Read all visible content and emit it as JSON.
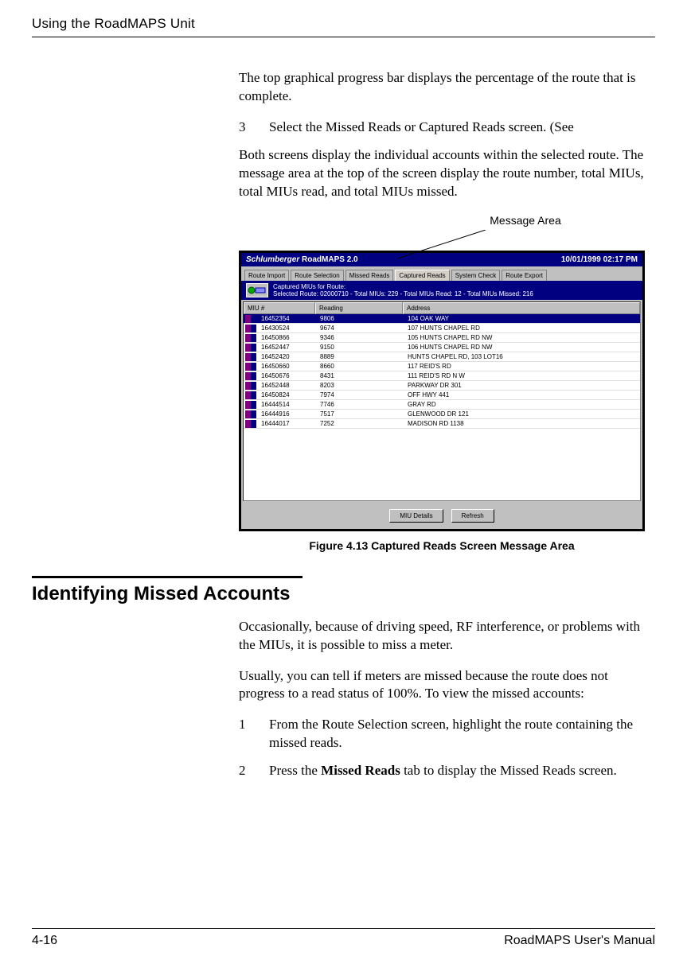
{
  "header": {
    "title": "Using the RoadMAPS Unit"
  },
  "intro": {
    "p1": "The top graphical progress bar displays the percentage of the route that is complete.",
    "step3_num": "3",
    "step3_text": "Select the Missed Reads or Captured Reads screen. (See",
    "step3_body": "Both screens display the individual accounts within the selected route. The message area at the top of the screen display the route number, total MIUs, total MIUs read, and total MIUs missed."
  },
  "callout": {
    "label": "Message Area"
  },
  "app": {
    "brand": "Schlumberger",
    "product": "RoadMAPS 2.0",
    "datetime": "10/01/1999 02:17 PM",
    "tabs": [
      "Route Import",
      "Route Selection",
      "Missed Reads",
      "Captured Reads",
      "System Check",
      "Route Export"
    ],
    "active_tab_index": 3,
    "msg_line1": "Captured MIUs for Route:",
    "msg_line2": "Selected Route: 02000710 - Total MIUs: 229 - Total MIUs Read: 12 - Total MIUs Missed: 216",
    "columns": {
      "miu": "MIU #",
      "reading": "Reading",
      "address": "Address"
    },
    "rows": [
      {
        "miu": "16452354",
        "reading": "9806",
        "address": "104 OAK WAY",
        "selected": true
      },
      {
        "miu": "16430524",
        "reading": "9674",
        "address": "107 HUNTS CHAPEL RD"
      },
      {
        "miu": "16450866",
        "reading": "9346",
        "address": "105 HUNTS CHAPEL RD NW"
      },
      {
        "miu": "16452447",
        "reading": "9150",
        "address": "106 HUNTS CHAPEL RD NW"
      },
      {
        "miu": "16452420",
        "reading": "8889",
        "address": "HUNTS CHAPEL RD, 103 LOT16"
      },
      {
        "miu": "16450660",
        "reading": "8660",
        "address": "117 REID'S RD"
      },
      {
        "miu": "16450676",
        "reading": "8431",
        "address": "111 REID'S RD N W"
      },
      {
        "miu": "16452448",
        "reading": "8203",
        "address": "PARKWAY DR 301"
      },
      {
        "miu": "16450824",
        "reading": "7974",
        "address": "OFF HWY 441"
      },
      {
        "miu": "16444514",
        "reading": "7746",
        "address": "GRAY RD"
      },
      {
        "miu": "16444916",
        "reading": "7517",
        "address": "GLENWOOD DR 121"
      },
      {
        "miu": "16444017",
        "reading": "7252",
        "address": "MADISON RD 1138"
      }
    ],
    "buttons": {
      "details": "MIU Details",
      "refresh": "Refresh"
    }
  },
  "figure": {
    "caption": "Figure 4.13   Captured Reads Screen Message Area"
  },
  "section": {
    "heading": "Identifying Missed Accounts",
    "p1": "Occasionally, because of driving speed, RF interference, or problems with the MIUs, it is possible to miss a meter.",
    "p2": "Usually, you can tell if meters are missed because the route does not progress to a read status of 100%. To view the missed accounts:",
    "step1_num": "1",
    "step1_text": "From the Route Selection screen, highlight the route containing the missed reads.",
    "step2_num": "2",
    "step2_text_a": "Press the ",
    "step2_bold": "Missed Reads",
    "step2_text_b": " tab to display the Missed Reads screen."
  },
  "footer": {
    "left": "4-16",
    "right": "RoadMAPS User's Manual"
  }
}
